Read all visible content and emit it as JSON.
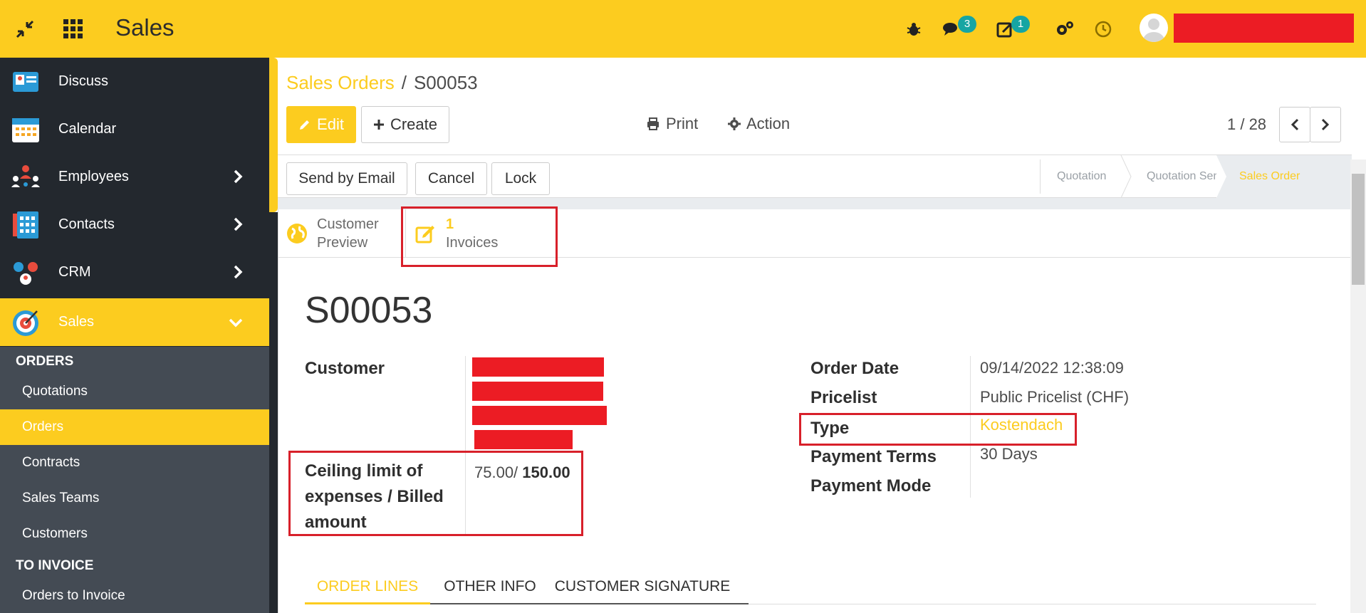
{
  "topbar": {
    "app_title": "Sales",
    "messages_count": "3",
    "activities_count": "1",
    "icons": [
      "collapse-icon",
      "apps-grid-icon",
      "bug-icon",
      "chat-icon",
      "activity-icon",
      "settings-icon",
      "clock-icon"
    ],
    "accent_color": "#fccc1f",
    "badge_color": "#16a5a3"
  },
  "sidebar": {
    "items": [
      {
        "label": "Discuss",
        "icon": "discuss-icon"
      },
      {
        "label": "Calendar",
        "icon": "calendar-icon"
      },
      {
        "label": "Employees",
        "icon": "employees-icon"
      },
      {
        "label": "Contacts",
        "icon": "contacts-icon"
      },
      {
        "label": "CRM",
        "icon": "crm-icon"
      },
      {
        "label": "Sales",
        "icon": "sales-icon"
      }
    ],
    "section_orders": "ORDERS",
    "orders_items": [
      "Quotations",
      "Orders",
      "Contracts",
      "Sales Teams",
      "Customers"
    ],
    "section_to_invoice": "TO INVOICE",
    "to_invoice_items": [
      "Orders to Invoice"
    ]
  },
  "breadcrumb": {
    "parent": "Sales Orders",
    "separator": "/",
    "current": "S00053"
  },
  "toolbar": {
    "edit_label": "Edit",
    "create_label": "Create",
    "print_label": "Print",
    "action_label": "Action",
    "pager": "1 / 28"
  },
  "statusbar": {
    "send_email_label": "Send by Email",
    "cancel_label": "Cancel",
    "lock_label": "Lock",
    "stages": [
      "Quotation",
      "Quotation Sent",
      "Sales Order"
    ],
    "current_stage": "Sales Order"
  },
  "smart_buttons": {
    "preview_line1": "Customer",
    "preview_line2": "Preview",
    "invoices_count": "1",
    "invoices_label": "Invoices"
  },
  "record": {
    "name": "S00053",
    "customer_label": "Customer",
    "ceiling_label_l1": "Ceiling limit of",
    "ceiling_label_l2": "expenses / Billed",
    "ceiling_label_l3": "amount",
    "ceiling_value": "75.00/",
    "billed_value": "150.00",
    "order_date_label": "Order Date",
    "order_date": "09/14/2022 12:38:09",
    "pricelist_label": "Pricelist",
    "pricelist": "Public Pricelist (CHF)",
    "type_label": "Type",
    "type": "Kostendach",
    "payment_terms_label": "Payment Terms",
    "payment_terms": "30 Days",
    "payment_mode_label": "Payment Mode"
  },
  "tabs": [
    "ORDER LINES",
    "OTHER INFO",
    "CUSTOMER SIGNATURE"
  ]
}
